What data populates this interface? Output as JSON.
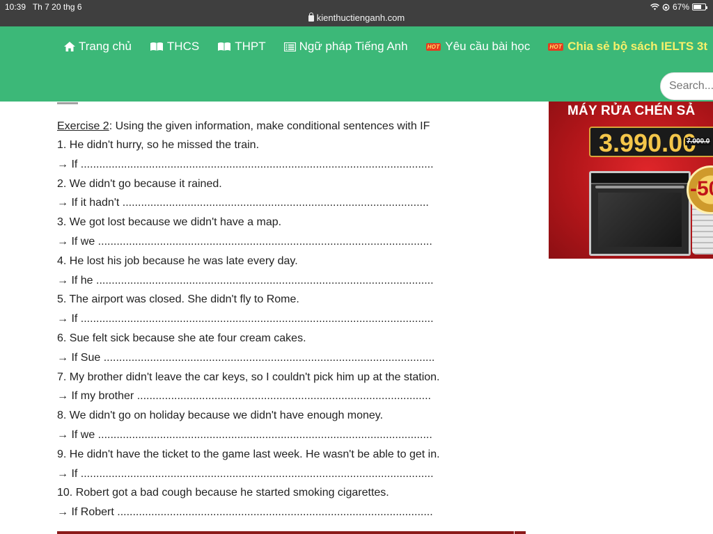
{
  "status_bar": {
    "time": "10:39",
    "date": "Th 7 20 thg 6",
    "url": "kienthuctienganh.com",
    "battery": "67%",
    "battery_level": 0.67
  },
  "nav": {
    "items": [
      {
        "label": "Trang chủ",
        "icon": "home-icon"
      },
      {
        "label": "THCS",
        "icon": "book-icon"
      },
      {
        "label": "THPT",
        "icon": "book-icon"
      },
      {
        "label": "Ngữ pháp Tiếng Anh",
        "icon": "list-icon"
      },
      {
        "label": "Yêu cầu bài học",
        "icon": "hot-badge-icon"
      },
      {
        "label": "Chia sẻ bộ sách IELTS 3t",
        "icon": "hot-badge-icon"
      }
    ],
    "hot_text": "HOT",
    "search_placeholder": "Search..."
  },
  "exercise": {
    "label": "Exercise 2",
    "instruction": ": Using the given information, make conditional sentences with IF",
    "items": [
      {
        "question": "1. He didn't hurry, so he missed the train.",
        "answer": "→ If .................................................................................................................."
      },
      {
        "question": "2. We didn't go because it rained.",
        "answer": "→ If it hadn't ..................................................................................................."
      },
      {
        "question": "3. We got lost because we didn't have a map.",
        "answer": "→ If we ............................................................................................................"
      },
      {
        "question": "4. He lost his job because he was late every day.",
        "answer": "→ If he ............................................................................................................."
      },
      {
        "question": "5. The airport was closed. She didn't fly to Rome.",
        "answer": "→ If .................................................................................................................."
      },
      {
        "question": "6. Sue felt sick because she ate four cream cakes.",
        "answer": "→ If Sue ..........................................................................................................."
      },
      {
        "question": "7. My brother didn't leave the car keys, so I couldn't pick him up at the station.",
        "answer": "→ If my brother ..............................................................................................."
      },
      {
        "question": "8. We didn't go on holiday because we didn't have enough money.",
        "answer": "→ If we ............................................................................................................"
      },
      {
        "question": "9. He didn't have the ticket to the game last week. He wasn't be able to get in.",
        "answer": "→ If .................................................................................................................."
      },
      {
        "question": "10. Robert got a bad cough because he started smoking cigarettes.",
        "answer": "→ If Robert ......................................................................................................"
      }
    ]
  },
  "ad": {
    "title": "MÁY RỬA CHÉN SẢ",
    "price": "3.990.00",
    "old_price": "7.000.0",
    "discount": "-50"
  },
  "colors": {
    "nav_green": "#3cb878",
    "hot_yellow": "#f7f06a",
    "ad_red": "#c4181c"
  }
}
